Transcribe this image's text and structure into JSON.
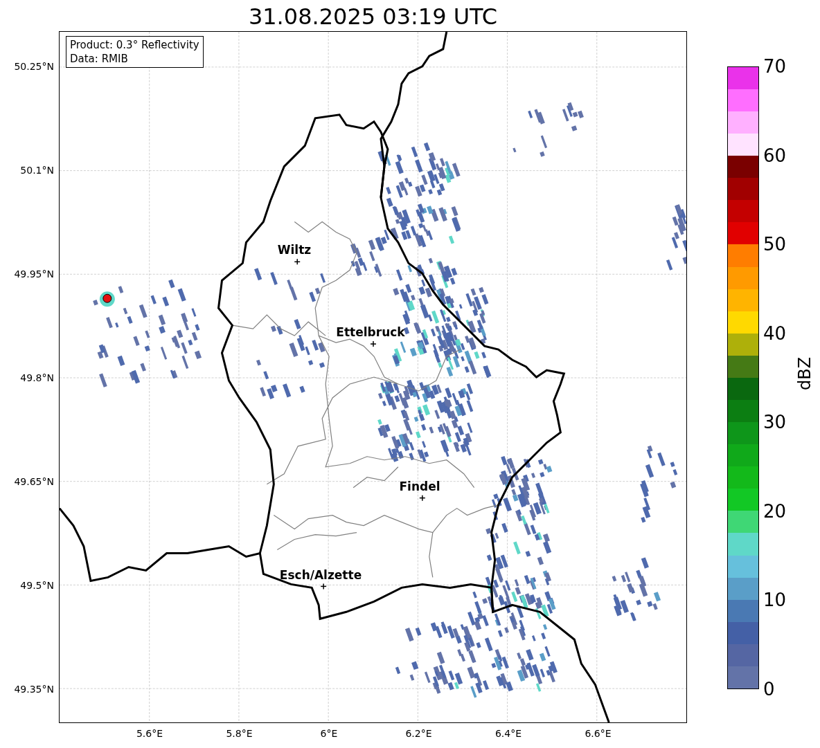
{
  "title": "31.08.2025 03:19 UTC",
  "map": {
    "legend": [
      "Product: 0.3° Reflectivity",
      "Data: RMIB"
    ],
    "lat_ticks": [
      "50.25°N",
      "50.1°N",
      "49.95°N",
      "49.8°N",
      "49.65°N",
      "49.5°N",
      "49.35°N"
    ],
    "lon_ticks": [
      "5.6°E",
      "5.8°E",
      "6°E",
      "6.2°E",
      "6.4°E",
      "6.6°E"
    ],
    "cities": [
      {
        "name": "Wiltz"
      },
      {
        "name": "Ettelbruck"
      },
      {
        "name": "Findel"
      },
      {
        "name": "Esch/Alzette"
      }
    ]
  },
  "colorbar": {
    "label": "dBZ",
    "ticks": [
      "70",
      "60",
      "50",
      "40",
      "30",
      "20",
      "10",
      "0"
    ],
    "segments": [
      {
        "color": "#6373a8"
      },
      {
        "color": "#5566a3"
      },
      {
        "color": "#4460a6"
      },
      {
        "color": "#4a79b3"
      },
      {
        "color": "#5a9ec8"
      },
      {
        "color": "#66c0dc"
      },
      {
        "color": "#5fd8c8"
      },
      {
        "color": "#3fd775"
      },
      {
        "color": "#12c825"
      },
      {
        "color": "#13b91a"
      },
      {
        "color": "#10a91a"
      },
      {
        "color": "#0e961a"
      },
      {
        "color": "#0c7e12"
      },
      {
        "color": "#0a680f"
      },
      {
        "color": "#457a15"
      },
      {
        "color": "#aeb00a"
      },
      {
        "color": "#ffd900"
      },
      {
        "color": "#ffb400"
      },
      {
        "color": "#ff9a00"
      },
      {
        "color": "#ff7d00"
      },
      {
        "color": "#e10000"
      },
      {
        "color": "#c40000"
      },
      {
        "color": "#a10000"
      },
      {
        "color": "#7a0000"
      },
      {
        "color": "#ffe3ff"
      },
      {
        "color": "#ffb0ff"
      },
      {
        "color": "#ff6eff"
      },
      {
        "color": "#ea32ea"
      }
    ]
  }
}
